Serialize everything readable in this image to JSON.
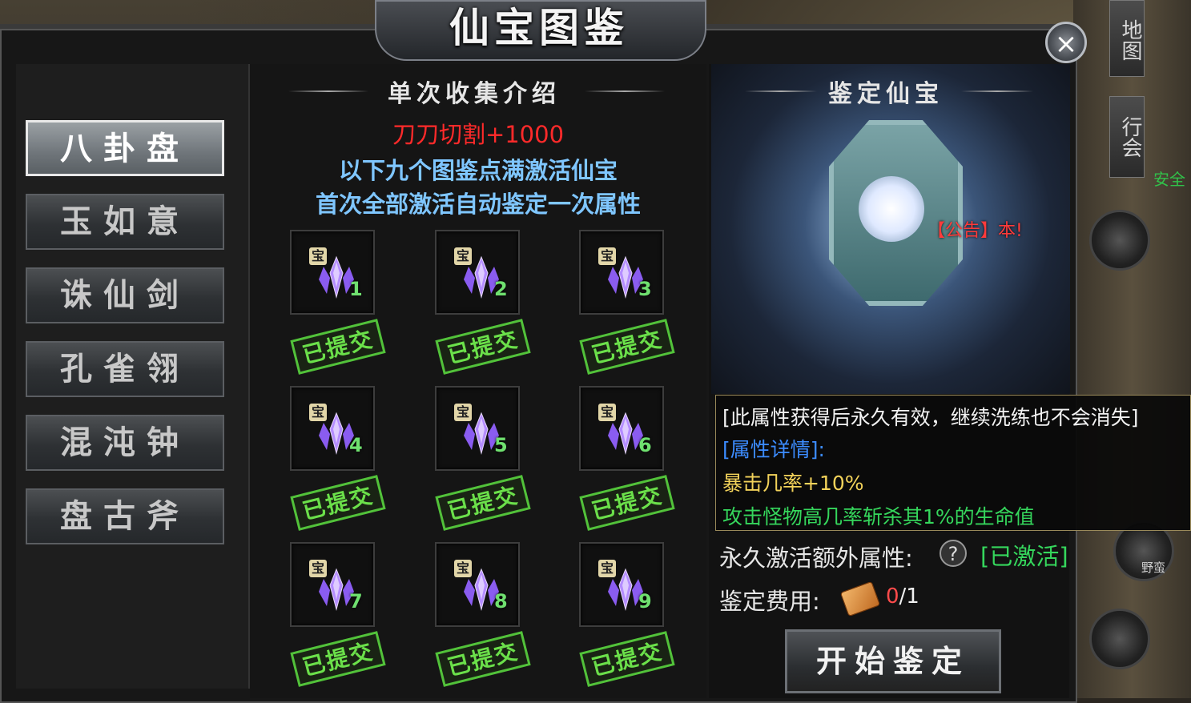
{
  "title": "仙宝图鉴",
  "close_label": "×",
  "side_ui": {
    "map": "地图",
    "guild": "行会",
    "safe": "安全",
    "wild": "野蛮"
  },
  "nav": {
    "items": [
      {
        "label": "八卦盘",
        "active": true
      },
      {
        "label": "玉如意",
        "active": false
      },
      {
        "label": "诛仙剑",
        "active": false
      },
      {
        "label": "孔雀翎",
        "active": false
      },
      {
        "label": "混沌钟",
        "active": false
      },
      {
        "label": "盘古斧",
        "active": false
      }
    ]
  },
  "collect": {
    "title": "单次收集介绍",
    "bonus": "刀刀切割+1000",
    "hint1": "以下九个图鉴点满激活仙宝",
    "hint2": "首次全部激活自动鉴定一次属性",
    "slot_badge": "宝",
    "stamp_label": "已提交",
    "slots": [
      "1",
      "2",
      "3",
      "4",
      "5",
      "6",
      "7",
      "8",
      "9"
    ]
  },
  "appraise": {
    "title": "鉴定仙宝",
    "notice": "【公告】本!",
    "tooltip": {
      "line1": "[此属性获得后永久有效，继续洗练也不会消失]",
      "line2": "[属性详情]:",
      "line3": "暴击几率+10%",
      "line4": "攻击怪物高几率斩杀其1%的生命值"
    },
    "extra_label": "永久激活额外属性:",
    "help": "?",
    "extra_status": "[已激活]",
    "cost_label": "鉴定费用:",
    "cost_have": "0",
    "cost_need": "/1",
    "start_button": "开始鉴定"
  },
  "colors": {
    "red": "#ff2a2a",
    "blue": "#7fc6ff",
    "green": "#35d65c",
    "gold": "#f2d25a"
  }
}
